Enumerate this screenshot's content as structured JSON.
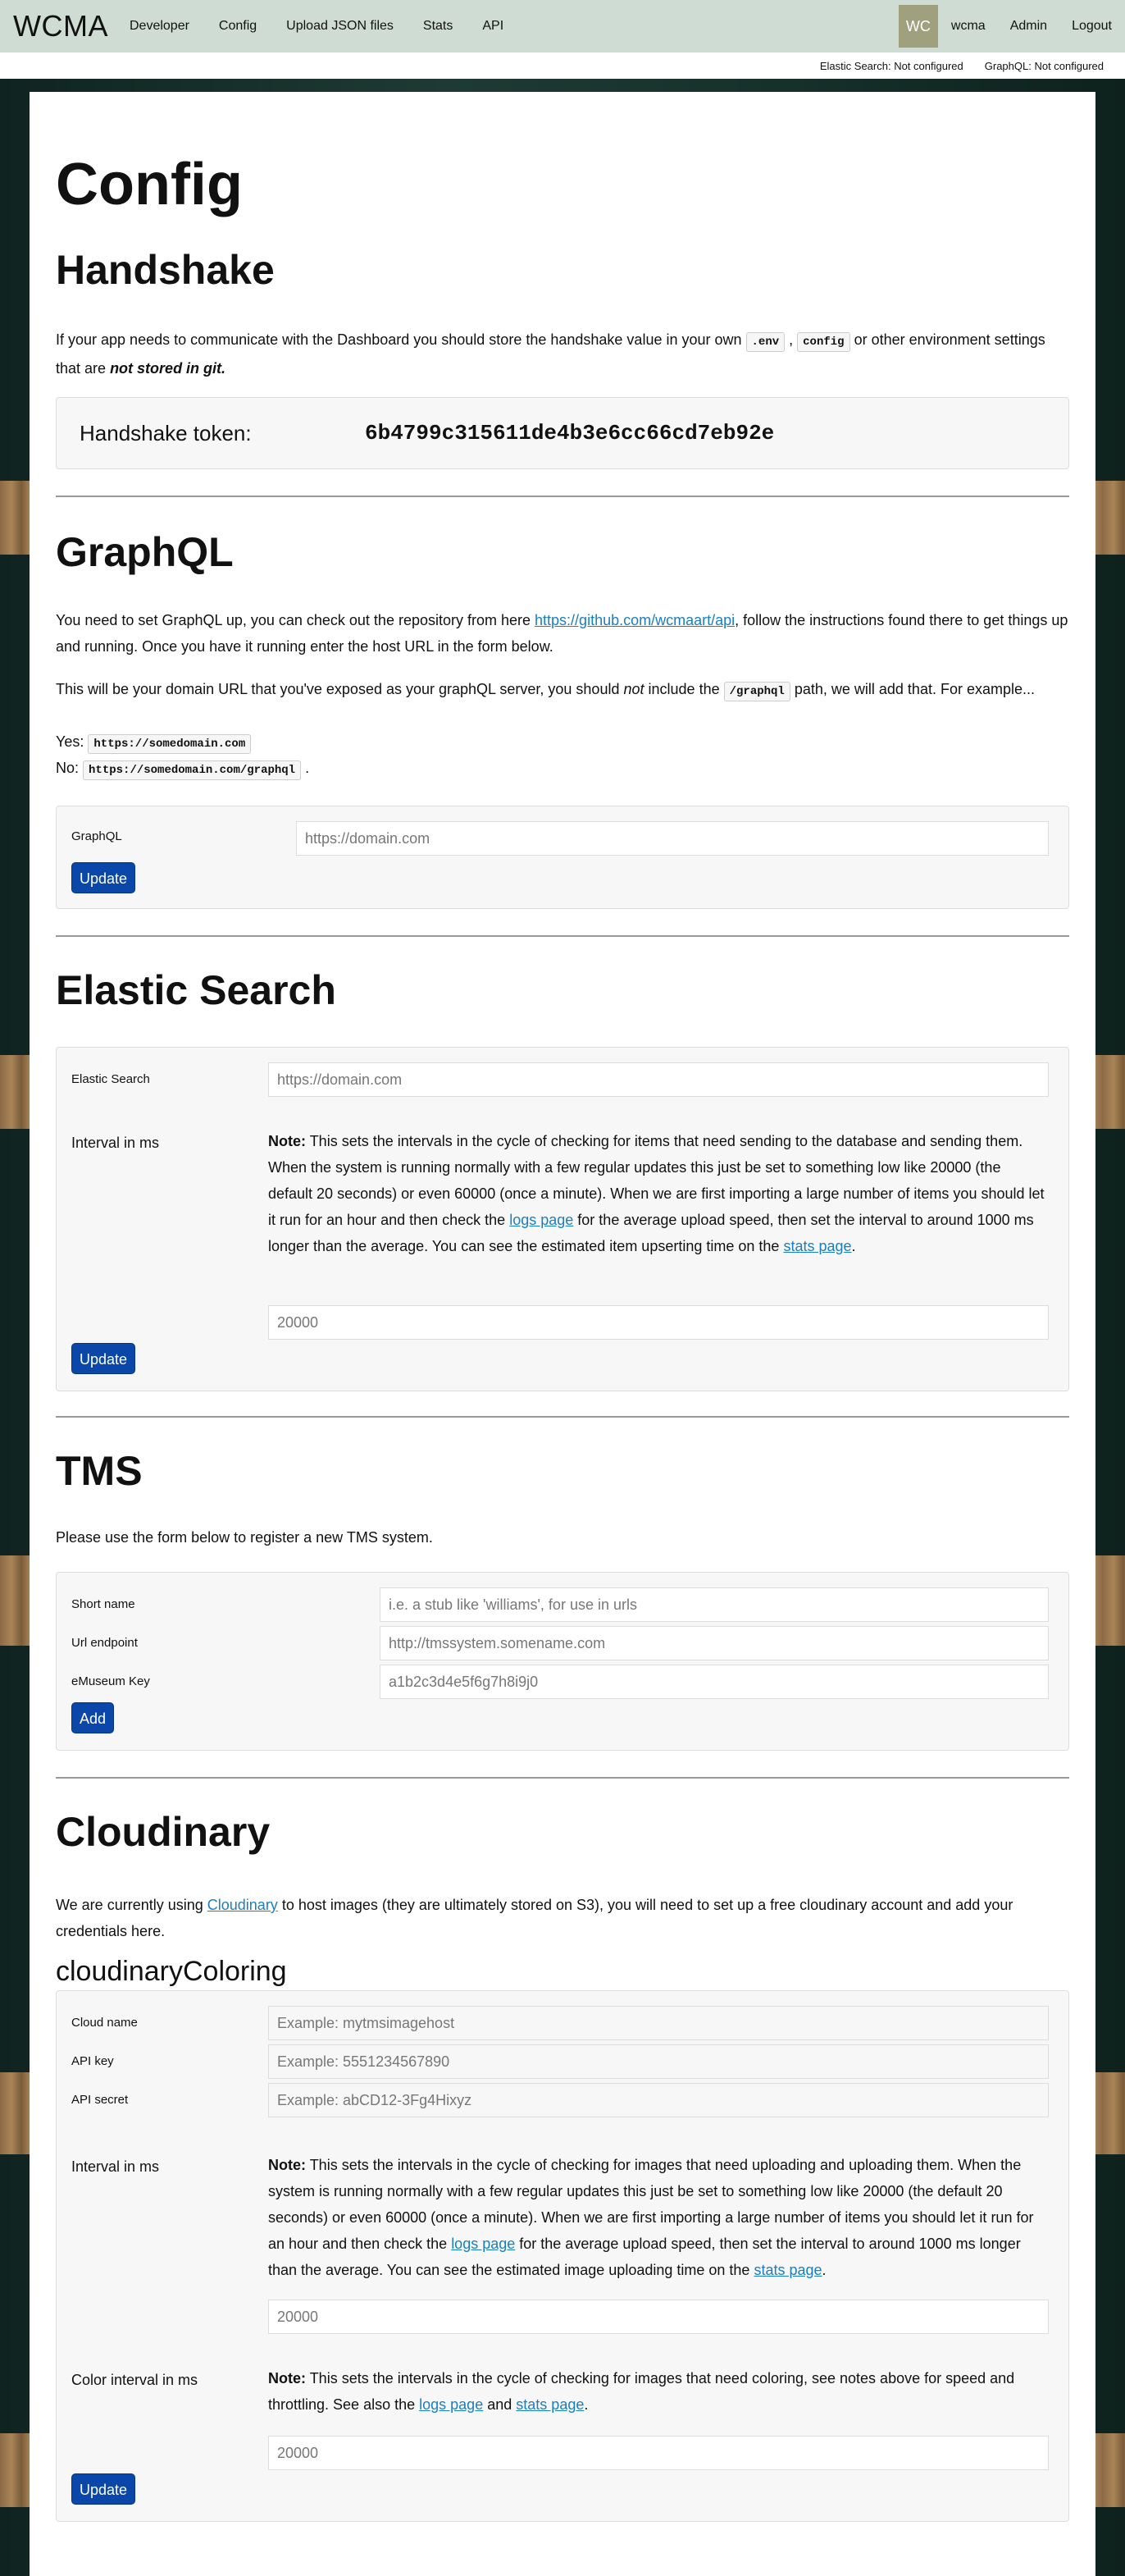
{
  "nav": {
    "brand": "WCMA",
    "links": [
      "Developer",
      "Config",
      "Upload JSON files",
      "Stats",
      "API"
    ],
    "avatar": "WC",
    "user": "wcma",
    "admin": "Admin",
    "logout": "Logout"
  },
  "status": {
    "elastic": "Elastic Search: Not configured",
    "graphql": "GraphQL: Not configured"
  },
  "page": {
    "title": "Config"
  },
  "handshake": {
    "heading": "Handshake",
    "text1": "If your app needs to communicate with the Dashboard you should store the handshake value in your own",
    "code1": ".env",
    "code2": "config",
    "text2": "or other environment settings that are",
    "emph": "not stored in git.",
    "token_label": "Handshake token:",
    "token_value": "6b4799c315611de4b3e6cc66cd7eb92e"
  },
  "graphql": {
    "heading": "GraphQL",
    "p1_a": "You need to set GraphQL up, you can check out the repository from here",
    "p1_link": "https://github.com/wcmaart/api",
    "p1_b": ", follow the instructions found there to get things up and running. Once you have it running enter the host URL in the form below.",
    "p2_a": "This will be your domain URL that you've exposed as your graphQL server, you should",
    "p2_not": "not",
    "p2_b": "include the",
    "p2_code": "/graphql",
    "p2_c": "path, we will add that. For example...",
    "yes_label": "Yes:",
    "yes_code": "https://somedomain.com",
    "no_label": "No:",
    "no_code": "https://somedomain.com/graphql",
    "no_end": ".",
    "field_label": "GraphQL",
    "field_placeholder": "https://domain.com",
    "button": "Update"
  },
  "elastic": {
    "heading": "Elastic Search",
    "field_label": "Elastic Search",
    "field_placeholder": "https://domain.com",
    "interval_label": "Interval in ms",
    "note_bold": "Note:",
    "note_a": "This sets the intervals in the cycle of checking for items that need sending to the database and sending them. When the system is running normally with a few regular updates this just be set to something low like 20000 (the default 20 seconds) or even 60000 (once a minute). When we are first importing a large number of items you should let it run for an hour and then check the",
    "logs_link": "logs page",
    "note_b": "for the average upload speed, then set the interval to around 1000 ms longer than the average. You can see the estimated item upserting time on the",
    "stats_link": "stats page",
    "note_c": ".",
    "interval_value": "20000",
    "button": "Update"
  },
  "tms": {
    "heading": "TMS",
    "intro": "Please use the form below to register a new TMS system.",
    "short_label": "Short name",
    "short_placeholder": "i.e. a stub like 'williams', for use in urls",
    "url_label": "Url endpoint",
    "url_placeholder": "http://tmssystem.somename.com",
    "key_label": "eMuseum Key",
    "key_placeholder": "a1b2c3d4e5f6g7h8i9j0",
    "button": "Add"
  },
  "cloudinary": {
    "heading": "Cloudinary",
    "intro_a": "We are currently using",
    "intro_link": "Cloudinary",
    "intro_b": "to host images (they are ultimately stored on S3), you will need to set up a free cloudinary account and add your credentials here.",
    "subheading": "cloudinaryColoring",
    "name_label": "Cloud name",
    "name_placeholder": "Example: mytmsimagehost",
    "key_label": "API key",
    "key_placeholder": "Example: 5551234567890",
    "secret_label": "API secret",
    "secret_placeholder": "Example: abCD12-3Fg4Hixyz",
    "interval_label": "Interval in ms",
    "note_bold": "Note:",
    "note_a": "This sets the intervals in the cycle of checking for images that need uploading and uploading them. When the system is running normally with a few regular updates this just be set to something low like 20000 (the default 20 seconds) or even 60000 (once a minute). When we are first importing a large number of items you should let it run for an hour and then check the",
    "logs_link": "logs page",
    "note_b": "for the average upload speed, then set the interval to around 1000 ms longer than the average. You can see the estimated image uploading time on the",
    "stats_link": "stats page",
    "note_c": ".",
    "interval_value": "20000",
    "color_label": "Color interval in ms",
    "color_note_a": "This sets the intervals in the cycle of checking for images that need coloring, see notes above for speed and throttling. See also the",
    "color_logs_link": "logs page",
    "color_and": "and",
    "color_stats_link": "stats page",
    "color_end": ".",
    "color_value": "20000",
    "button": "Update"
  }
}
